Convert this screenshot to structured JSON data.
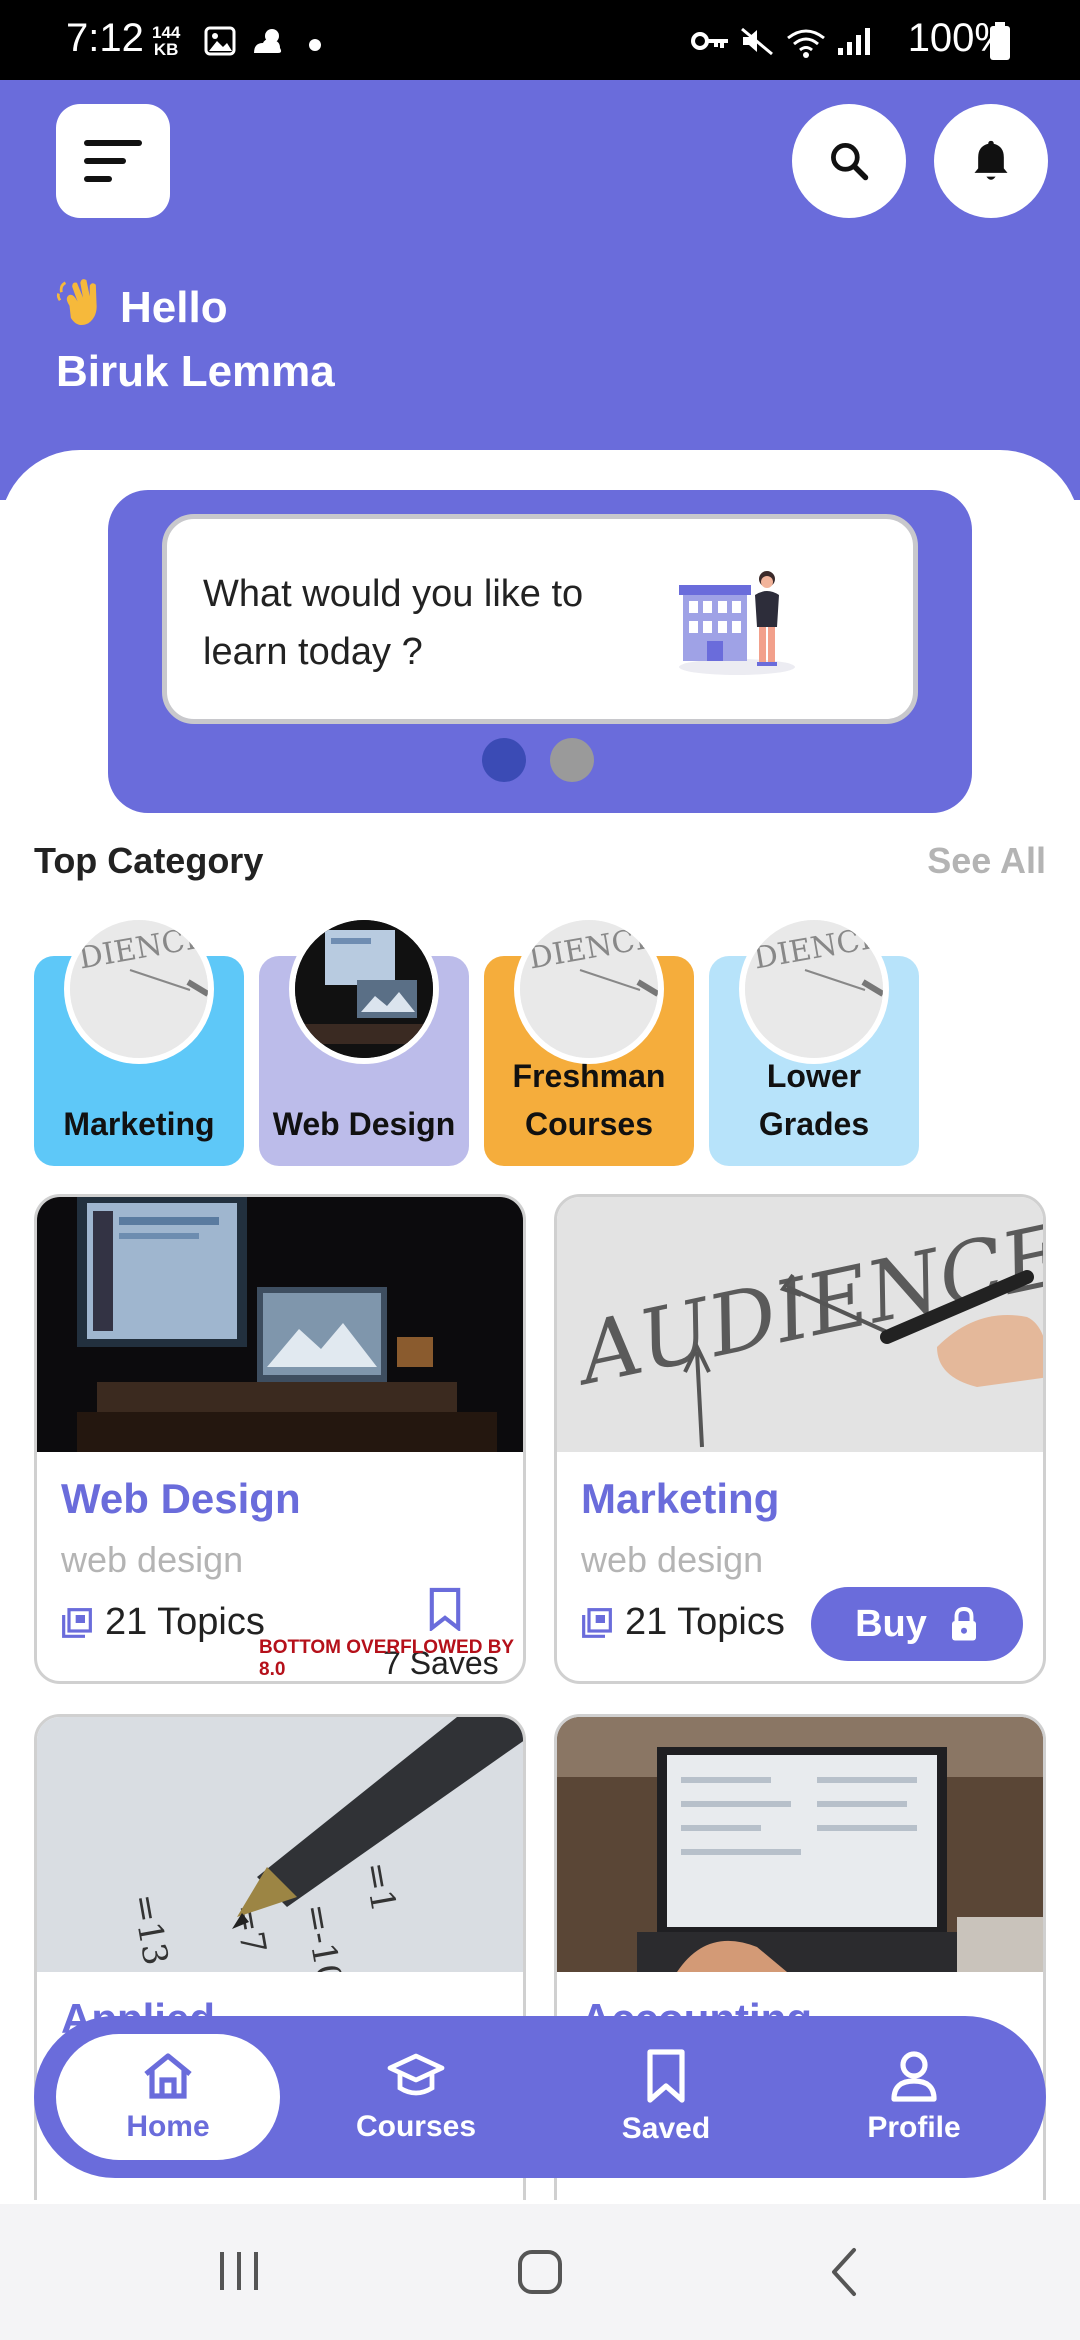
{
  "status_bar": {
    "time": "7:12",
    "net_speed_value": "144",
    "net_speed_unit": "KB",
    "battery": "100%"
  },
  "header": {
    "greeting": "Hello",
    "user_name": "Biruk Lemma"
  },
  "banner": {
    "text": "What would you like to learn today ?",
    "active_slide": 1,
    "slide_count": 2
  },
  "top_category": {
    "title": "Top Category",
    "see_all": "See All",
    "items": [
      {
        "label": "Marketing",
        "color": "#5ec8f8"
      },
      {
        "label": "Web Design",
        "color": "#bcbcea"
      },
      {
        "label": "Freshman Courses",
        "color": "#f5ad3c"
      },
      {
        "label": "Lower Grades",
        "color": "#b7e3fa"
      }
    ]
  },
  "courses": [
    {
      "title": "Web Design",
      "subtitle": "web design",
      "topics": "21 Topics",
      "saves": "7 Saves",
      "overflow_warning": "BOTTOM OVERFLOWED BY 8.0"
    },
    {
      "title": "Marketing",
      "subtitle": "web design",
      "topics": "21 Topics",
      "buy_label": "Buy"
    },
    {
      "title": "Applied"
    },
    {
      "title": "Accounting"
    }
  ],
  "bottom_nav": {
    "items": [
      {
        "label": "Home",
        "icon": "home-icon",
        "active": true
      },
      {
        "label": "Courses",
        "icon": "graduation-cap-icon",
        "active": false
      },
      {
        "label": "Saved",
        "icon": "bookmark-icon",
        "active": false
      },
      {
        "label": "Profile",
        "icon": "person-icon",
        "active": false
      }
    ]
  },
  "colors": {
    "primary": "#6a6cdb",
    "muted_text": "#b4b4b4",
    "dot_active": "#3b4bb5",
    "dot_inactive": "#9a9a9a"
  }
}
